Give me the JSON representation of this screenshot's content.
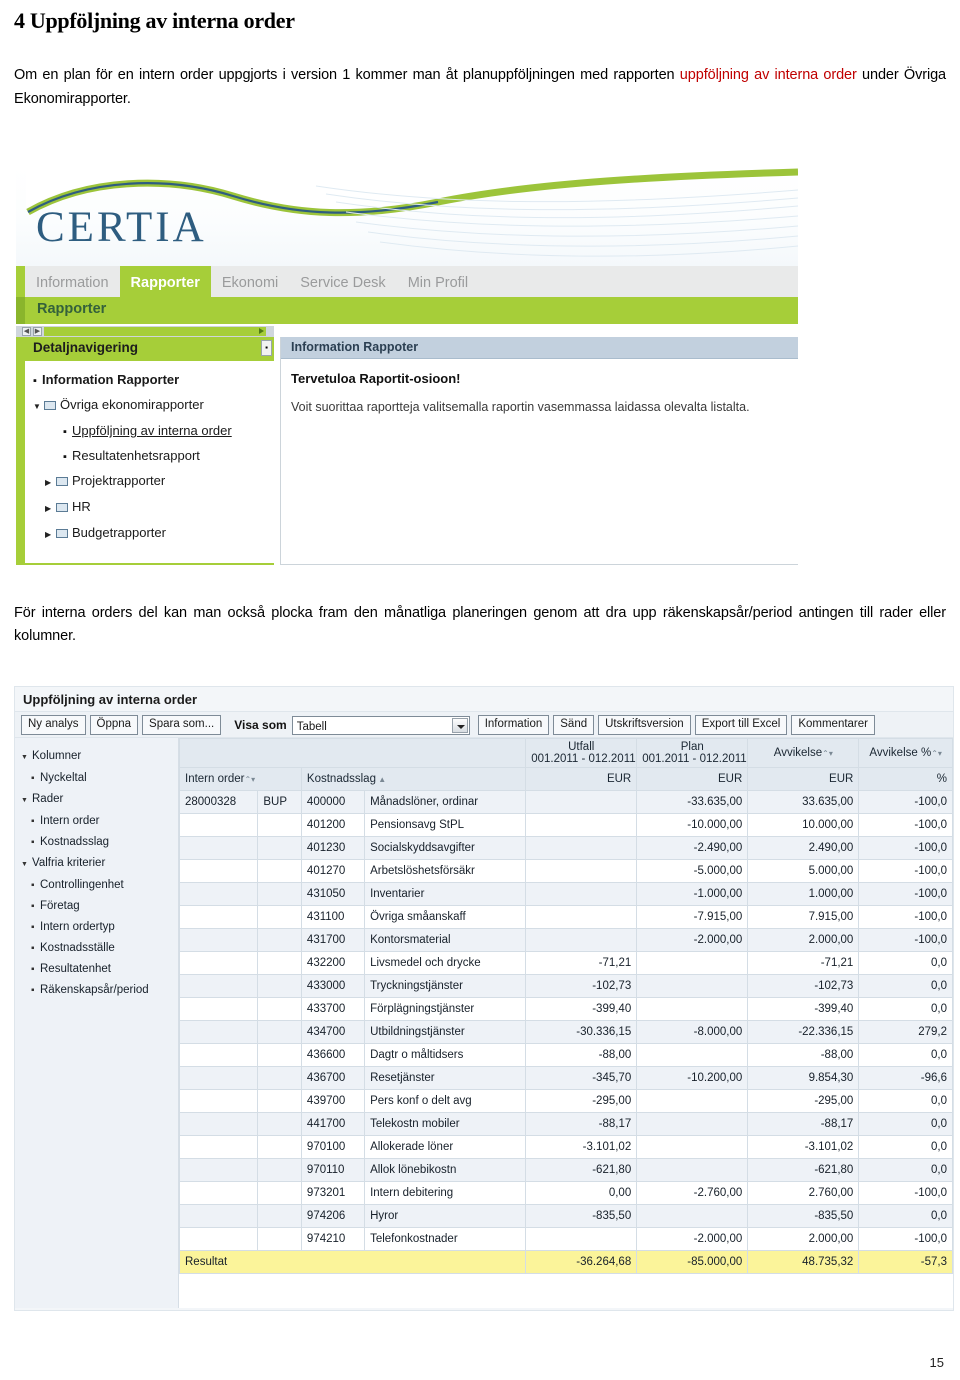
{
  "document": {
    "heading": "4 Uppföljning av interna order",
    "paragraph1_pre": "Om en plan för en intern order uppgjorts i version 1 kommer man åt planuppföljningen med rapporten ",
    "paragraph1_link": "uppföljning av interna order",
    "paragraph1_post": " under Övriga Ekonomirapporter.",
    "paragraph2": "För interna orders del kan man också plocka fram den månatliga planeringen genom att dra upp räkenskapsår/period antingen till rader eller kolumner.",
    "page_number": "15"
  },
  "portal": {
    "logo_text": "CERTIA",
    "nav": [
      {
        "label": "Information",
        "active": false
      },
      {
        "label": "Rapporter",
        "active": true
      },
      {
        "label": "Ekonomi",
        "active": false
      },
      {
        "label": "Service Desk",
        "active": false
      },
      {
        "label": "Min Profil",
        "active": false
      }
    ],
    "subbar_label": "Rapporter",
    "navpane_title": "Detaljnavigering",
    "tree": [
      {
        "label": "Information Rapporter",
        "level": 0,
        "kind": "bullet",
        "bold": true,
        "underline": false
      },
      {
        "label": "Övriga ekonomirapporter",
        "level": 0,
        "kind": "folder-open",
        "bold": false,
        "underline": false
      },
      {
        "label": "Uppföljning av interna order",
        "level": 2,
        "kind": "bullet",
        "bold": false,
        "underline": true
      },
      {
        "label": "Resultatenhetsrapport",
        "level": 2,
        "kind": "bullet",
        "bold": false,
        "underline": false
      },
      {
        "label": "Projektrapporter",
        "level": 0,
        "kind": "folder-closed",
        "bold": false,
        "underline": false
      },
      {
        "label": "HR",
        "level": 0,
        "kind": "folder-closed",
        "bold": false,
        "underline": false
      },
      {
        "label": "Budgetrapporter",
        "level": 0,
        "kind": "folder-closed",
        "bold": false,
        "underline": false
      }
    ],
    "info_header": "Information Rappoter",
    "info_line1": "Tervetuloa Raportit-osioon!",
    "info_line2": "Voit suorittaa raportteja valitsemalla raportin vasemmassa laidassa olevalta listalta."
  },
  "report": {
    "title": "Uppföljning av interna order",
    "toolbar": {
      "new_analysis": "Ny analys",
      "open": "Öppna",
      "save_as": "Spara som...",
      "show_as_label": "Visa som",
      "show_as_value": "Tabell",
      "information": "Information",
      "send": "Sänd",
      "print_version": "Utskriftsversion",
      "export_excel": "Export till Excel",
      "comments": "Kommentarer"
    },
    "side_tree": [
      {
        "label": "Kolumner",
        "level": 0,
        "kind": "tri"
      },
      {
        "label": "Nyckeltal",
        "level": 1,
        "kind": "bul"
      },
      {
        "label": "Rader",
        "level": 0,
        "kind": "tri"
      },
      {
        "label": "Intern order",
        "level": 1,
        "kind": "bul"
      },
      {
        "label": "Kostnadsslag",
        "level": 1,
        "kind": "bul"
      },
      {
        "label": "Valfria kriterier",
        "level": 0,
        "kind": "tri"
      },
      {
        "label": "Controllingenhet",
        "level": 1,
        "kind": "bul"
      },
      {
        "label": "Företag",
        "level": 1,
        "kind": "bul"
      },
      {
        "label": "Intern ordertyp",
        "level": 1,
        "kind": "bul"
      },
      {
        "label": "Kostnadsställe",
        "level": 1,
        "kind": "bul"
      },
      {
        "label": "Resultatenhet",
        "level": 1,
        "kind": "bul"
      },
      {
        "label": "Räkenskapsår/period",
        "level": 1,
        "kind": "bul"
      }
    ],
    "table": {
      "group_headers": {
        "utfall_l1": "Utfall",
        "utfall_l2": "001.2011 - 012.2011",
        "plan_l1": "Plan",
        "plan_l2": "001.2011 - 012.2011",
        "avvikelse": "Avvikelse",
        "avvikelse_pct": "Avvikelse %"
      },
      "sub_headers": {
        "intern_order": "Intern order",
        "kostnadsslag": "Kostnadsslag",
        "utfall_unit": "EUR",
        "plan_unit": "EUR",
        "avvikelse_unit": "EUR",
        "pct_unit": "%"
      },
      "rows": [
        {
          "io": "28000328",
          "bup": "BUP",
          "ks": "400000",
          "desc": "Månadslöner, ordinar",
          "utfall": "",
          "plan": "-33.635,00",
          "avv": "33.635,00",
          "pct": "-100,0"
        },
        {
          "io": "",
          "bup": "",
          "ks": "401200",
          "desc": "Pensionsavg StPL",
          "utfall": "",
          "plan": "-10.000,00",
          "avv": "10.000,00",
          "pct": "-100,0"
        },
        {
          "io": "",
          "bup": "",
          "ks": "401230",
          "desc": "Socialskyddsavgifter",
          "utfall": "",
          "plan": "-2.490,00",
          "avv": "2.490,00",
          "pct": "-100,0"
        },
        {
          "io": "",
          "bup": "",
          "ks": "401270",
          "desc": "Arbetslöshetsförsäkr",
          "utfall": "",
          "plan": "-5.000,00",
          "avv": "5.000,00",
          "pct": "-100,0"
        },
        {
          "io": "",
          "bup": "",
          "ks": "431050",
          "desc": "Inventarier",
          "utfall": "",
          "plan": "-1.000,00",
          "avv": "1.000,00",
          "pct": "-100,0"
        },
        {
          "io": "",
          "bup": "",
          "ks": "431100",
          "desc": "Övriga småanskaff",
          "utfall": "",
          "plan": "-7.915,00",
          "avv": "7.915,00",
          "pct": "-100,0"
        },
        {
          "io": "",
          "bup": "",
          "ks": "431700",
          "desc": "Kontorsmaterial",
          "utfall": "",
          "plan": "-2.000,00",
          "avv": "2.000,00",
          "pct": "-100,0"
        },
        {
          "io": "",
          "bup": "",
          "ks": "432200",
          "desc": "Livsmedel och drycke",
          "utfall": "-71,21",
          "plan": "",
          "avv": "-71,21",
          "pct": "0,0"
        },
        {
          "io": "",
          "bup": "",
          "ks": "433000",
          "desc": "Tryckningstjänster",
          "utfall": "-102,73",
          "plan": "",
          "avv": "-102,73",
          "pct": "0,0"
        },
        {
          "io": "",
          "bup": "",
          "ks": "433700",
          "desc": "Förplägningstjänster",
          "utfall": "-399,40",
          "plan": "",
          "avv": "-399,40",
          "pct": "0,0"
        },
        {
          "io": "",
          "bup": "",
          "ks": "434700",
          "desc": "Utbildningstjänster",
          "utfall": "-30.336,15",
          "plan": "-8.000,00",
          "avv": "-22.336,15",
          "pct": "279,2"
        },
        {
          "io": "",
          "bup": "",
          "ks": "436600",
          "desc": "Dagtr o måltidsers",
          "utfall": "-88,00",
          "plan": "",
          "avv": "-88,00",
          "pct": "0,0"
        },
        {
          "io": "",
          "bup": "",
          "ks": "436700",
          "desc": "Resetjänster",
          "utfall": "-345,70",
          "plan": "-10.200,00",
          "avv": "9.854,30",
          "pct": "-96,6"
        },
        {
          "io": "",
          "bup": "",
          "ks": "439700",
          "desc": "Pers konf o delt avg",
          "utfall": "-295,00",
          "plan": "",
          "avv": "-295,00",
          "pct": "0,0"
        },
        {
          "io": "",
          "bup": "",
          "ks": "441700",
          "desc": "Telekostn mobiler",
          "utfall": "-88,17",
          "plan": "",
          "avv": "-88,17",
          "pct": "0,0"
        },
        {
          "io": "",
          "bup": "",
          "ks": "970100",
          "desc": "Allokerade löner",
          "utfall": "-3.101,02",
          "plan": "",
          "avv": "-3.101,02",
          "pct": "0,0"
        },
        {
          "io": "",
          "bup": "",
          "ks": "970110",
          "desc": "Allok lönebikostn",
          "utfall": "-621,80",
          "plan": "",
          "avv": "-621,80",
          "pct": "0,0"
        },
        {
          "io": "",
          "bup": "",
          "ks": "973201",
          "desc": "Intern debitering",
          "utfall": "0,00",
          "plan": "-2.760,00",
          "avv": "2.760,00",
          "pct": "-100,0"
        },
        {
          "io": "",
          "bup": "",
          "ks": "974206",
          "desc": "Hyror",
          "utfall": "-835,50",
          "plan": "",
          "avv": "-835,50",
          "pct": "0,0"
        },
        {
          "io": "",
          "bup": "",
          "ks": "974210",
          "desc": "Telefonkostnader",
          "utfall": "",
          "plan": "-2.000,00",
          "avv": "2.000,00",
          "pct": "-100,0"
        }
      ],
      "total": {
        "label": "Resultat",
        "utfall": "-36.264,68",
        "plan": "-85.000,00",
        "avv": "48.735,32",
        "pct": "-57,3"
      }
    }
  },
  "colors": {
    "brand_green": "#a6ce39",
    "link_red": "#c00000",
    "total_yellow": "#fbf49a"
  }
}
